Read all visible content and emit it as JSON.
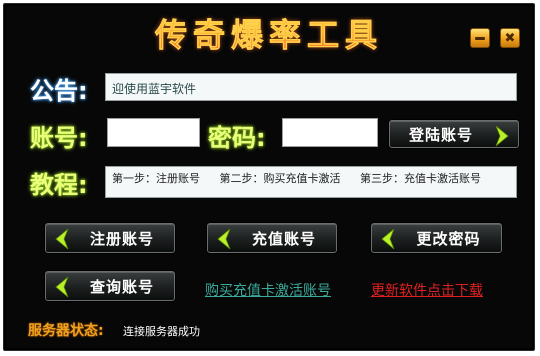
{
  "window": {
    "title": "传奇爆率工具",
    "minimize_icon": "minimize-icon",
    "close_icon": "close-icon",
    "close_glyph": "✖"
  },
  "notice": {
    "label": "公告:",
    "text": "迎使用蓝宇软件"
  },
  "login": {
    "account_label": "账号:",
    "account_value": "",
    "password_label": "密码:",
    "password_value": "",
    "login_button": "登陆账号"
  },
  "tutorial": {
    "label": "教程:",
    "steps": [
      "第一步：注册账号",
      "第二步：购买充值卡激活",
      "第三步：充值卡激活账号"
    ]
  },
  "actions": {
    "register": "注册账号",
    "recharge": "充值账号",
    "change_password": "更改密码",
    "query": "查询账号"
  },
  "links": {
    "buy_card": "购买充值卡激活账号",
    "update": "更新软件点击下载"
  },
  "status": {
    "label": "服务器状态:",
    "value": "连接服务器成功"
  },
  "colors": {
    "background": "#070707",
    "label_green": "#eaff7a",
    "chevron_green": "#b8f02a",
    "link_teal": "#3aaa9a",
    "link_red": "#e02020",
    "status_orange": "#f0a020"
  }
}
